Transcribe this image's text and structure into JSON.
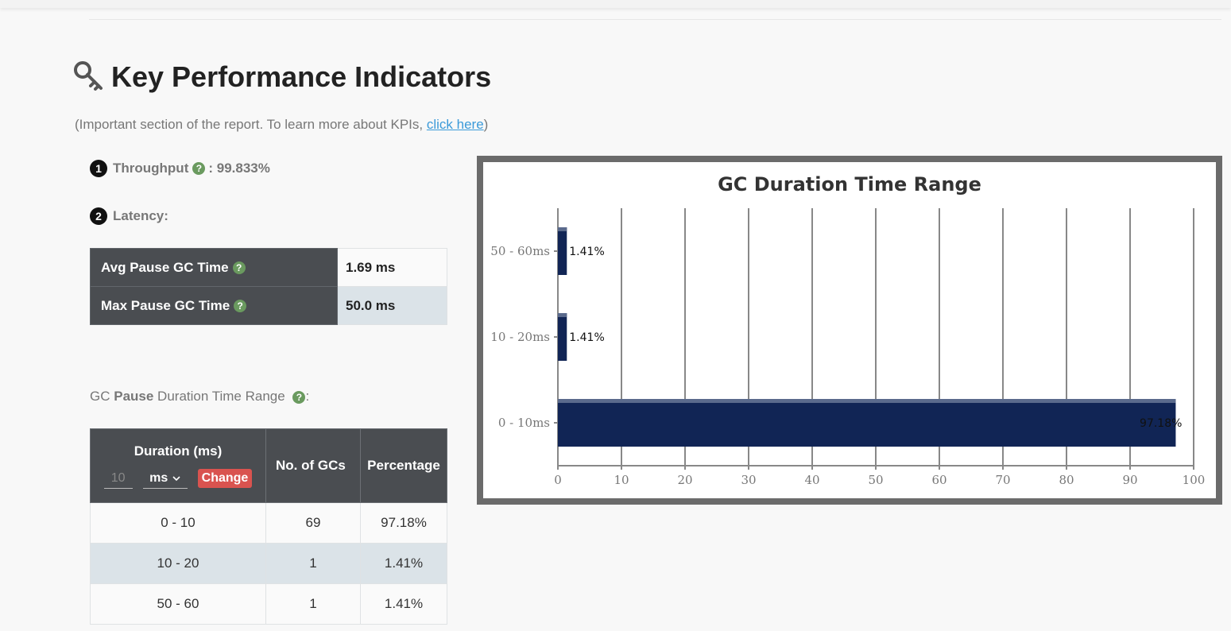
{
  "page": {
    "title": "Key Performance Indicators",
    "subtitle_prefix": "(Important section of the report. To learn more about KPIs, ",
    "subtitle_link": "click here",
    "subtitle_suffix": ")"
  },
  "throughput": {
    "number": "1",
    "label": "Throughput",
    "help": "?",
    "value": ": 99.833%"
  },
  "latency": {
    "number": "2",
    "label": "Latency:",
    "rows": [
      {
        "label": "Avg Pause GC Time",
        "help": "?",
        "value": "1.69 ms"
      },
      {
        "label": "Max Pause GC Time",
        "help": "?",
        "value": "50.0 ms"
      }
    ]
  },
  "range_section": {
    "prefix": "GC ",
    "bold": "Pause",
    "suffix": " Duration Time Range",
    "help": "?",
    "colon": ":"
  },
  "duration_table": {
    "headers": {
      "duration": "Duration (ms)",
      "count": "No. of GCs",
      "percentage": "Percentage"
    },
    "controls": {
      "input_value": "10",
      "unit": "ms",
      "change_label": "Change"
    },
    "rows": [
      {
        "range": "0 - 10",
        "count": "69",
        "pct": "97.18%"
      },
      {
        "range": "10 - 20",
        "count": "1",
        "pct": "1.41%"
      },
      {
        "range": "50 - 60",
        "count": "1",
        "pct": "1.41%"
      }
    ]
  },
  "colors": {
    "bar": "#112555",
    "header_bg": "#4a4d51",
    "change_button": "#d9534f",
    "help_icon": "#6a9a5f"
  },
  "chart_data": {
    "type": "bar",
    "orientation": "horizontal",
    "title": "GC Duration Time Range",
    "categories": [
      "0 - 10ms",
      "10 - 20ms",
      "50 - 60ms"
    ],
    "values": [
      97.18,
      1.41,
      1.41
    ],
    "labels": [
      "97.18%",
      "1.41%",
      "1.41%"
    ],
    "xlim": [
      0,
      100
    ],
    "xticks": [
      0,
      10,
      20,
      30,
      40,
      50,
      60,
      70,
      80,
      90,
      100
    ],
    "grid": true,
    "legend": "none"
  }
}
